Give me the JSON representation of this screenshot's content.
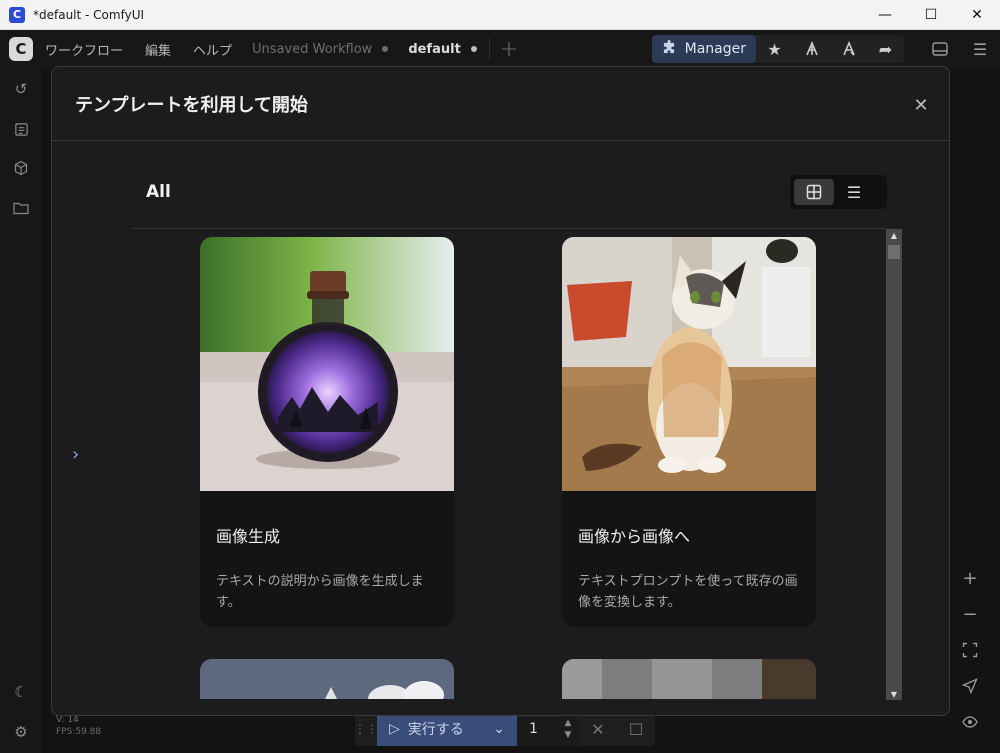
{
  "window": {
    "title": "*default - ComfyUI",
    "minimize": "—",
    "maximize": "☐",
    "close": "✕"
  },
  "menubar": {
    "items": [
      "ワークフロー",
      "編集",
      "ヘルプ"
    ],
    "tabs": [
      {
        "label": "Unsaved Workflow",
        "active": false
      },
      {
        "label": "default",
        "active": true
      }
    ],
    "manager_label": "Manager"
  },
  "modal": {
    "title": "テンプレートを利用して開始",
    "filter_label": "All",
    "templates": [
      {
        "title": "画像生成",
        "description": "テキストの説明から画像を生成します。"
      },
      {
        "title": "画像から画像へ",
        "description": "テキストプロンプトを使って既存の画像を変換します。"
      }
    ]
  },
  "runbar": {
    "run_label": "実行する",
    "count": "1"
  },
  "version": {
    "v": "V: 14",
    "fps": "FPS:59.88"
  },
  "colors": {
    "accent": "#3a4d78",
    "manager": "#2b3a55",
    "background": "#131313",
    "modal": "#1c1c1e"
  }
}
